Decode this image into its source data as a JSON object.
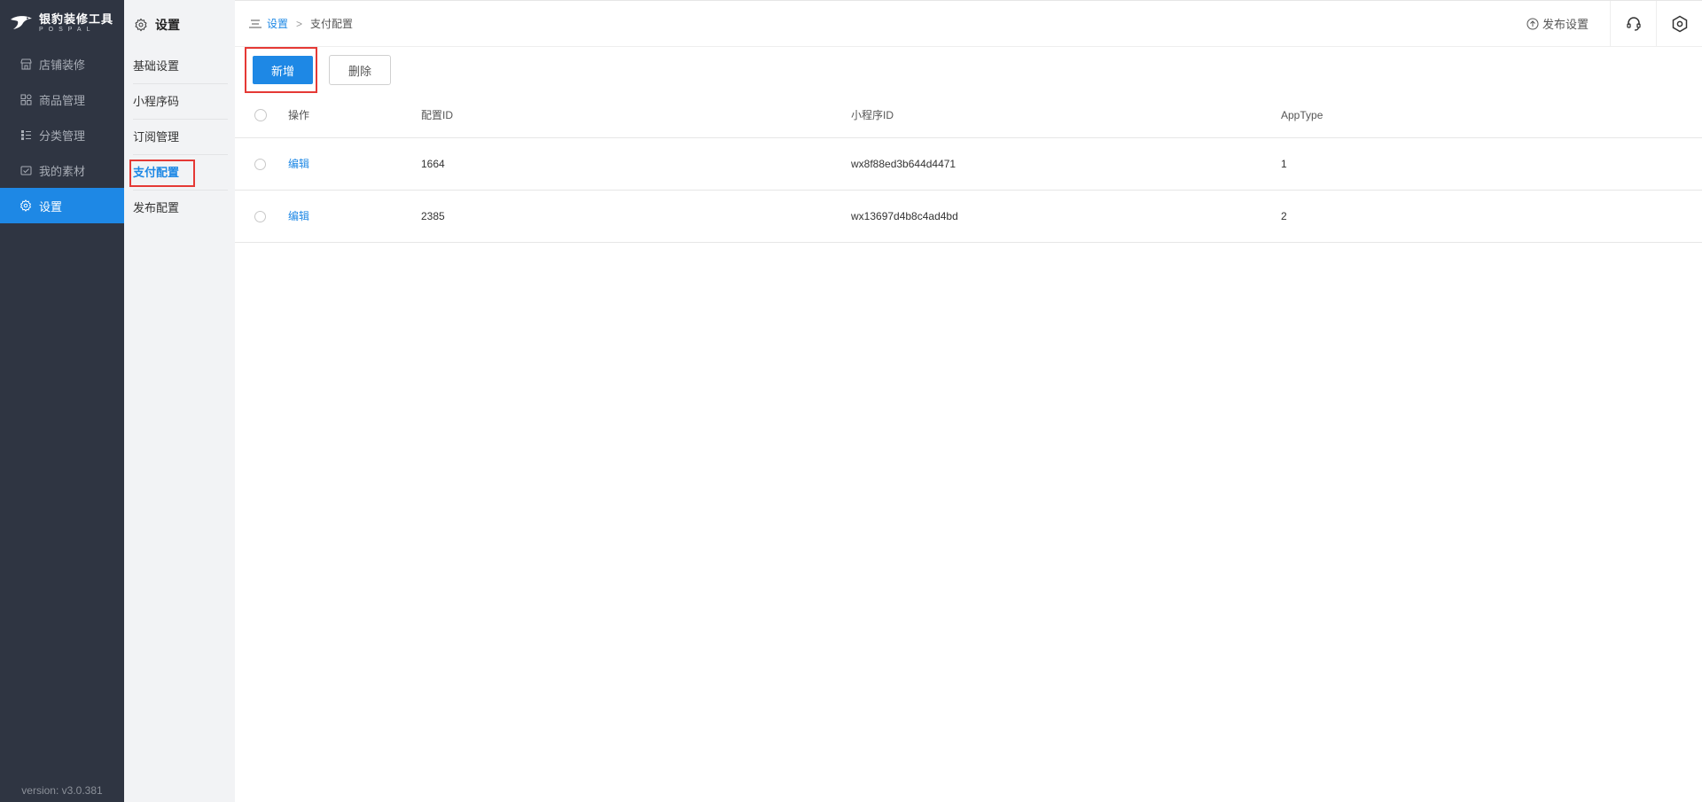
{
  "brand": {
    "name_cn": "银豹装修工具",
    "name_en": "POSPAL"
  },
  "sidebar": {
    "items": [
      {
        "label": "店铺装修",
        "icon": "store-icon",
        "active": false
      },
      {
        "label": "商品管理",
        "icon": "grid-icon",
        "active": false
      },
      {
        "label": "分类管理",
        "icon": "list-icon",
        "active": false
      },
      {
        "label": "我的素材",
        "icon": "image-check-icon",
        "active": false
      },
      {
        "label": "设置",
        "icon": "gear-icon",
        "active": true
      }
    ],
    "version": "version: v3.0.381"
  },
  "subsidebar": {
    "title": "设置",
    "items": [
      {
        "label": "基础设置",
        "active": false
      },
      {
        "label": "小程序码",
        "active": false
      },
      {
        "label": "订阅管理",
        "active": false
      },
      {
        "label": "支付配置",
        "active": true
      },
      {
        "label": "发布配置",
        "active": false
      }
    ]
  },
  "breadcrumb": {
    "parent": "设置",
    "separator": ">",
    "current": "支付配置"
  },
  "topbar": {
    "publish_label": "发布设置"
  },
  "toolbar": {
    "add_label": "新增",
    "delete_label": "删除"
  },
  "table": {
    "headers": {
      "op": "操作",
      "config_id": "配置ID",
      "mini_id": "小程序ID",
      "app_type": "AppType"
    },
    "rows": [
      {
        "op": "编辑",
        "config_id": "1664",
        "mini_id": "wx8f88ed3b644d4471",
        "app_type": "1"
      },
      {
        "op": "编辑",
        "config_id": "2385",
        "mini_id": "wx13697d4b8c4ad4bd",
        "app_type": "2"
      }
    ]
  },
  "colors": {
    "accent": "#1e88e5",
    "sidebar_bg": "#2f3542",
    "highlight": "#e53935"
  }
}
